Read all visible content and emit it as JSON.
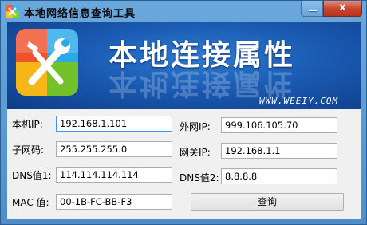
{
  "window": {
    "title": "本地网络信息查询工具",
    "close_label": "x"
  },
  "banner": {
    "title": "本地连接属性",
    "url": "WWW.WEEIY.COM"
  },
  "form": {
    "local_ip_label": "本机IP:",
    "local_ip_value": "192.168.1.101",
    "public_ip_label": "外网IP:",
    "public_ip_value": "999.106.105.70",
    "subnet_label": "子网码:",
    "subnet_value": "255.255.255.0",
    "gateway_label": "网关IP:",
    "gateway_value": "192.168.1.1",
    "dns1_label": "DNS值1:",
    "dns1_value": "114.114.114.114",
    "dns2_label": "DNS值2:",
    "dns2_value": "8.8.8.8",
    "mac_label": "MAC 值:",
    "mac_value": "00-1B-FC-BB-F3",
    "query_button": "查询"
  }
}
